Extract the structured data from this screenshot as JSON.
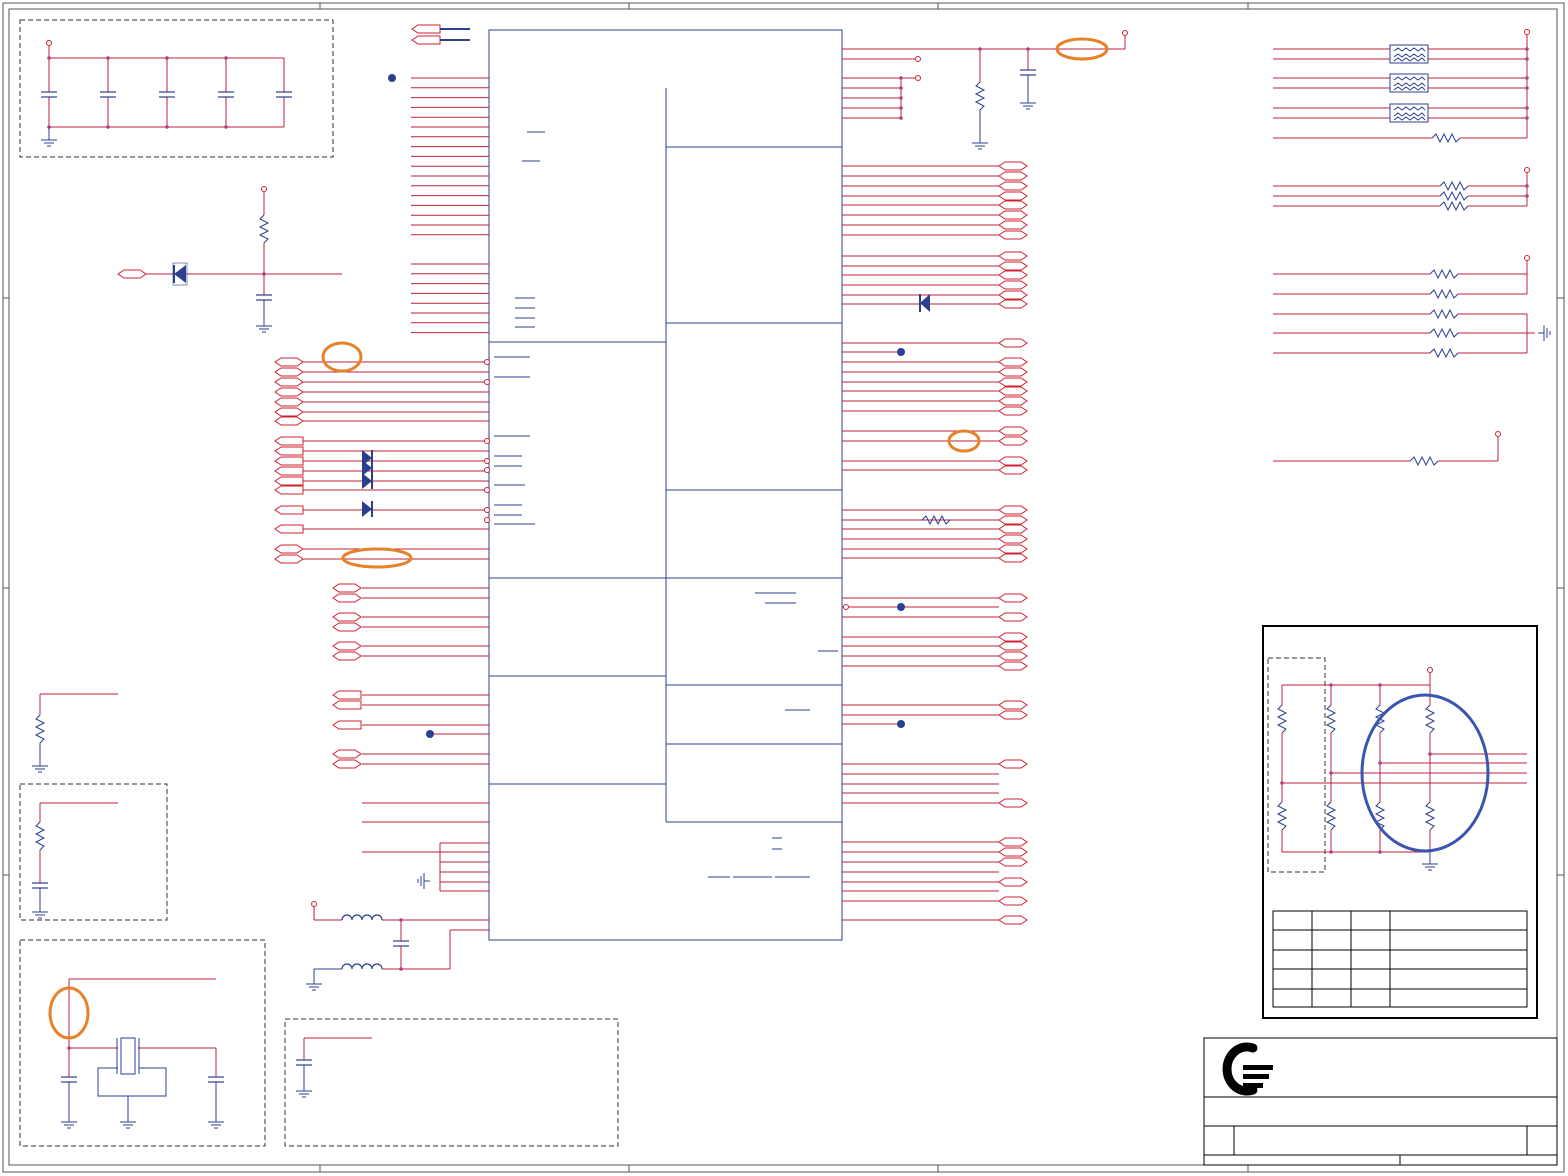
{
  "sheet": {
    "title": "",
    "background": "#ffffff"
  },
  "colors": {
    "net_wire": "#c0203a",
    "component": "#2b3f8f",
    "junction": "#b04080",
    "port": "#d02030",
    "highlight_orange": "#e8822a",
    "highlight_blue": "#3a55b0",
    "frame": "#555555",
    "logo": "#000000"
  },
  "icons": [
    "resistor-icon",
    "capacitor-icon",
    "inductor-icon",
    "diode-icon",
    "crystal-icon",
    "ground-icon",
    "power-pin-icon",
    "offpage-port-icon",
    "company-logo-icon"
  ],
  "revision_table": {
    "rows": 4,
    "columns": 4
  },
  "title_block": {
    "logo": "company-logo-icon"
  },
  "annotations": {
    "orange_highlights": 6,
    "blue_highlights": 1
  }
}
